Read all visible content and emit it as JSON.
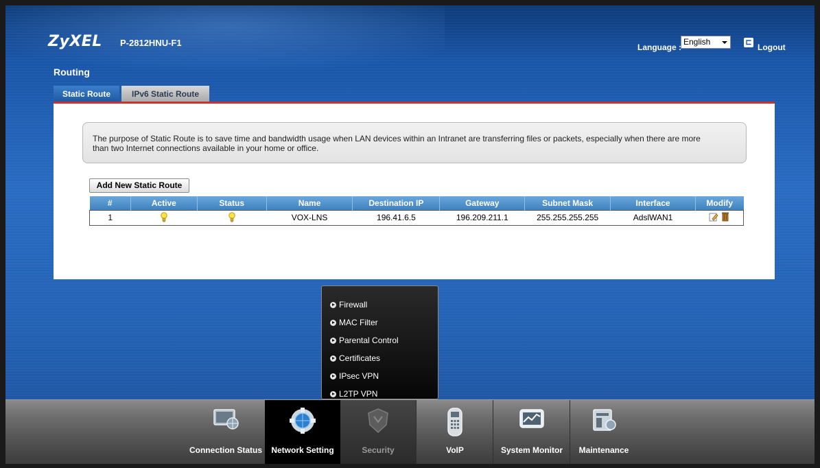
{
  "header": {
    "brand": "ZyXEL",
    "model": "P-2812HNU-F1",
    "language_label": "Language :",
    "language_value": "English",
    "logout_label": "Logout"
  },
  "page": {
    "title": "Routing",
    "tabs": [
      {
        "label": "Static Route",
        "active": true
      },
      {
        "label": "IPv6 Static Route",
        "active": false
      }
    ]
  },
  "info": {
    "text_line1": "The purpose of Static Route is to save time and bandwidth usage when LAN devices within an Intranet are transferring files or packets, especially when there are more",
    "text_line2": "than two Internet connections available in your home or office."
  },
  "actions": {
    "add_label": "Add New Static Route"
  },
  "table": {
    "columns": [
      "#",
      "Active",
      "Status",
      "Name",
      "Destination IP",
      "Gateway",
      "Subnet Mask",
      "Interface",
      "Modify"
    ],
    "rows": [
      {
        "num": "1",
        "name": "VOX-LNS",
        "destination_ip": "196.41.6.5",
        "gateway": "196.209.211.1",
        "subnet_mask": "255.255.255.255",
        "interface": "AdslWAN1"
      }
    ]
  },
  "submenu": {
    "items": [
      "Firewall",
      "MAC Filter",
      "Parental Control",
      "Certificates",
      "IPsec VPN",
      "L2TP VPN"
    ]
  },
  "navbar": {
    "items": [
      {
        "label": "Connection Status",
        "icon": "monitor-globe-icon",
        "state": "normal"
      },
      {
        "label": "Network Setting",
        "icon": "gear-globe-icon",
        "state": "selected"
      },
      {
        "label": "Security",
        "icon": "shield-icon",
        "state": "dark"
      },
      {
        "label": "VoIP",
        "icon": "phone-icon",
        "state": "normal"
      },
      {
        "label": "System Monitor",
        "icon": "chart-monitor-icon",
        "state": "normal"
      },
      {
        "label": "Maintenance",
        "icon": "tools-icon",
        "state": "normal"
      }
    ]
  },
  "colors": {
    "accent_red": "#c8322f",
    "header_blue": "#1a56a8",
    "table_header": "#4f8fcc"
  }
}
